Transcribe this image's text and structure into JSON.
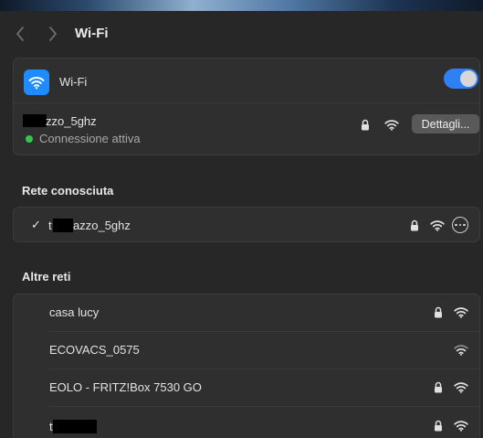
{
  "window": {
    "title": "Wi-Fi"
  },
  "wifi_toggle": {
    "label": "Wi-Fi",
    "enabled": true,
    "accent": "#2f7ff5"
  },
  "current_network": {
    "name_visible": "zzo_5ghz",
    "status": "Connessione attiva",
    "status_color": "#32c74c",
    "details_button": "Dettagli..."
  },
  "known_section": {
    "title": "Rete conosciuta",
    "networks": [
      {
        "prefix": "t",
        "name_visible": "azzo_5ghz",
        "secured": true,
        "checked": true
      }
    ]
  },
  "other_section": {
    "title": "Altre reti",
    "networks": [
      {
        "name": "casa lucy",
        "secured": true
      },
      {
        "name": "ECOVACS_0575",
        "secured": false
      },
      {
        "name": "EOLO - FRITZ!Box 7530 GO",
        "secured": true
      },
      {
        "prefix": "t",
        "name": "",
        "secured": true
      }
    ]
  },
  "icons": [
    "chevron-left-icon",
    "chevron-right-icon",
    "wifi-icon",
    "lock-icon",
    "checkmark-icon",
    "more-icon"
  ]
}
